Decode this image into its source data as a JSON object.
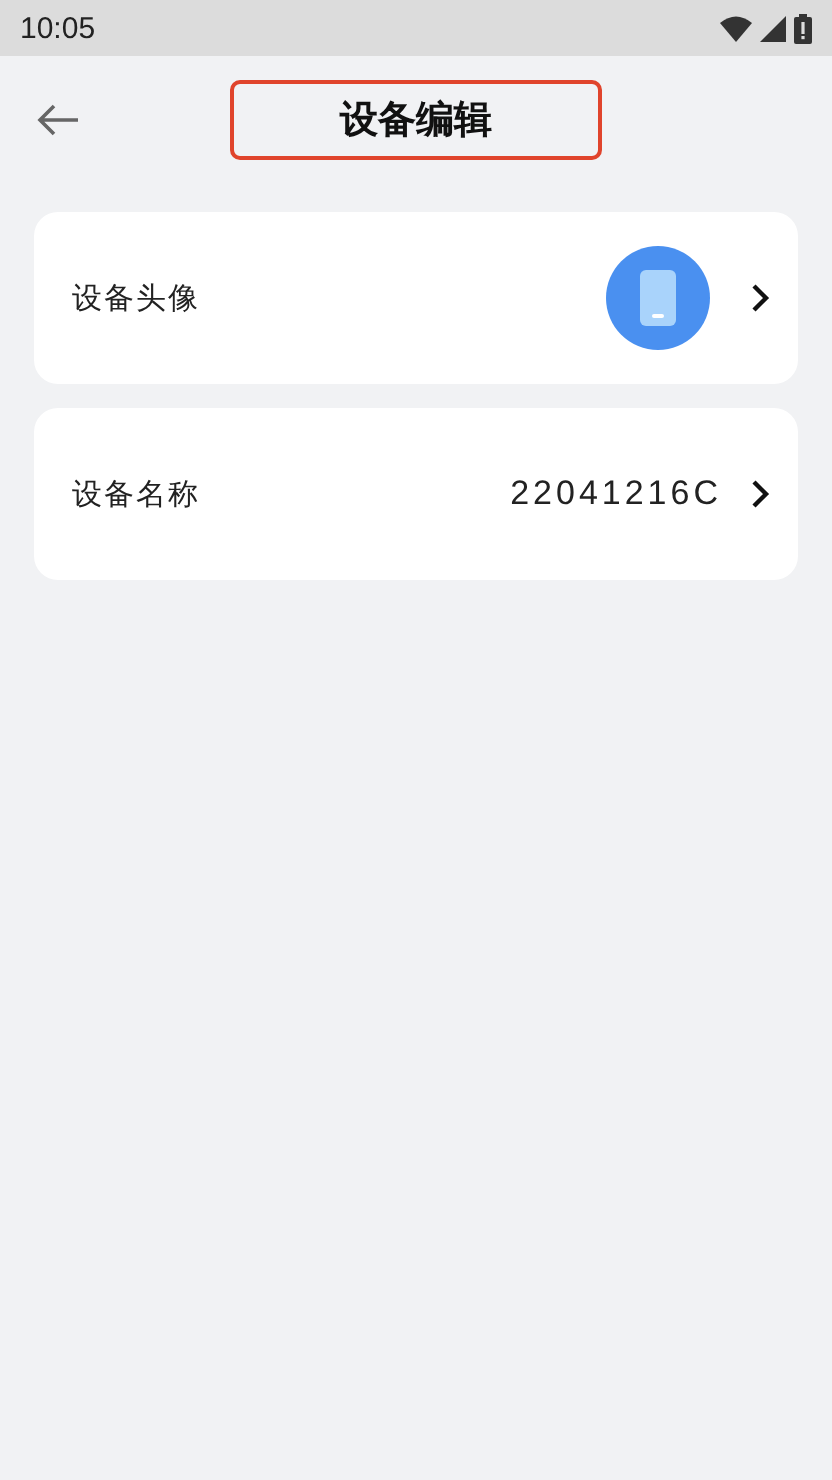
{
  "status_bar": {
    "time": "10:05"
  },
  "header": {
    "title": "设备编辑",
    "highlighted": true
  },
  "rows": [
    {
      "kind": "avatar",
      "label": "设备头像"
    },
    {
      "kind": "text",
      "label": "设备名称",
      "value": "22041216C"
    }
  ]
}
